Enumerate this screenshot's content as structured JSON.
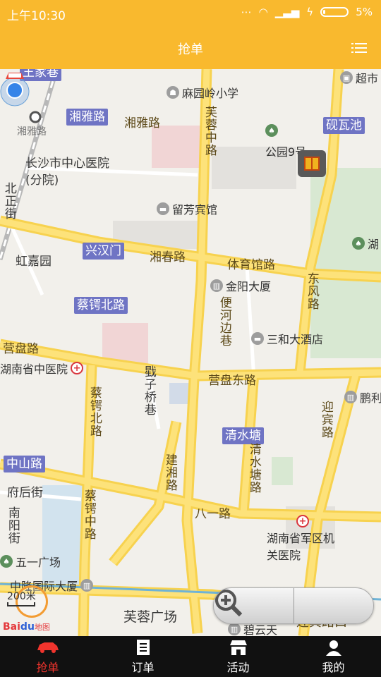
{
  "status_bar": {
    "time": "上午10:30",
    "battery": "5%"
  },
  "header": {
    "title": "抢单",
    "menu_icon": "list-menu-icon"
  },
  "map": {
    "chips": {
      "wangjiaxiang": "王家巷",
      "xiangya": "湘雅路",
      "yanwachi": "砚瓦池",
      "xinghanmen": "兴汉门",
      "caieshbei": "蔡锷北路",
      "qingshuitang": "清水塘",
      "zhongshan": "中山路"
    },
    "labels": {
      "xiangya_road": "湘雅路",
      "xiangya_station": "湘雅路",
      "furong_n": "芙蓉中路",
      "hospital": "长沙市中心医院(分院)",
      "beizheng": "北正街",
      "hongjia": "虹嘉园",
      "xiangchun": "湘春路",
      "tiyuguan": "体育馆路",
      "dongfeng": "东风路",
      "bianhe": "便河边巷",
      "yingpan": "营盘路",
      "yingpan_east": "营盘东路",
      "jizi": "戥子桥巷",
      "caie_n": "蔡锷北路",
      "qingshui_road": "清水塘路",
      "yingbin": "迎宾路",
      "jianxiang": "建湘路",
      "bayi": "八一路",
      "fuhou": "府后街",
      "nanyang": "南阳街",
      "caie_mid": "蔡锷中路",
      "furong_sq": "芙蓉广场",
      "yingbin_bottom": "迎宾路口"
    },
    "pois": {
      "maiyuanling": "麻园岭小学",
      "chaoshi": "超市",
      "park9": "公园9号",
      "liufang": "留芳宾馆",
      "hu": "湖",
      "jinyang": "金阳大厦",
      "sanhe": "三和大酒店",
      "tcm": "湖南省中医院",
      "peng": "鹏利",
      "military": "湖南省军区机关医院",
      "wuyi": "五一广场",
      "zhonglong": "中隆国际大厦",
      "biyuntian": "碧云天"
    },
    "scale": "200米",
    "baidu_logo": "Bai",
    "baidu_logo_suffix": "地图",
    "zoom_out_icon": "zoom-out-icon",
    "zoom_in_icon": "zoom-in-icon"
  },
  "nav": [
    {
      "label": "抢单",
      "icon": "car-icon",
      "active": true
    },
    {
      "label": "订单",
      "icon": "document-icon",
      "active": false
    },
    {
      "label": "活动",
      "icon": "store-icon",
      "active": false
    },
    {
      "label": "我的",
      "icon": "person-icon",
      "active": false
    }
  ],
  "colors": {
    "accent": "#f9b92e",
    "active_nav": "#f0342d",
    "chip": "#6f74c4",
    "road": "#fde27a"
  }
}
